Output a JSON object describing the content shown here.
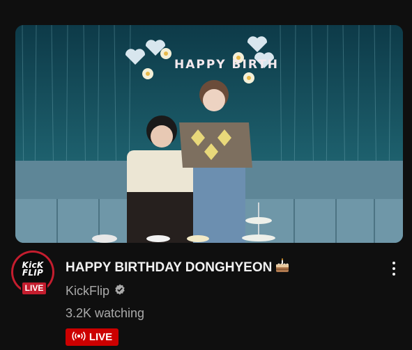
{
  "video": {
    "title": "HAPPY BIRTHDAY DONGHYEON",
    "title_emoji_icon": "cake-icon",
    "channel_name": "KickFlip",
    "channel_verified_icon": "verified-icon",
    "watching": "3.2K watching",
    "live_badge_label": "LIVE",
    "live_badge_icon": "live-broadcast-icon",
    "thumbnail_banner_text": "HAPPY BIRTH",
    "avatar": {
      "logo_line1": "KicK",
      "logo_line2": "FLIP",
      "live_label": "LIVE"
    },
    "menu_icon": "more-vertical-icon"
  },
  "colors": {
    "background": "#0f0f0f",
    "live_red": "#cc0000",
    "avatar_ring": "#c41d2e",
    "secondary_text": "#aaaaaa",
    "primary_text": "#f1f1f1"
  }
}
